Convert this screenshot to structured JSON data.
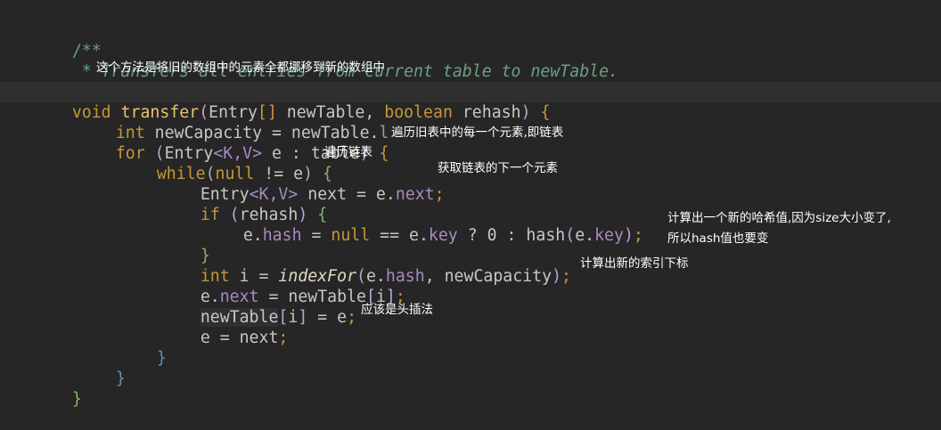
{
  "code": {
    "l1": "/**",
    "l2": " * Transfers all entries from current table to newTable.",
    "l3a": " */",
    "l4": {
      "kw": "void",
      "fn": "transfer",
      "p1": "(",
      "t1": "Entry",
      "b1": "[]",
      "v1": " newTable, ",
      "kw2": "boolean",
      "v2": " rehash",
      "p2": ")",
      "b2": " {"
    },
    "l5": {
      "kw": "int",
      "v": " newCapacity = newTable.",
      "f": "length",
      "s": ";"
    },
    "l6": {
      "kw": "for",
      "p1": " (",
      "t": "Entry",
      "g": "<K,V>",
      "v": " e : table",
      "p2": ")",
      "b": " {"
    },
    "l7": {
      "kw": "while",
      "p1": "(",
      "kw2": "null",
      "v": " != e",
      "p2": ")",
      "b": " {"
    },
    "l8": {
      "t": "Entry",
      "g": "<K,V>",
      "v": " next = e.",
      "f": "next",
      "s": ";"
    },
    "l9": {
      "kw": "if",
      "p1": " (",
      "v": "rehash",
      "p2": ")",
      "b": " {"
    },
    "l10": {
      "v1": "e.",
      "f1": "hash",
      "v2": " = ",
      "kw": "null",
      "v3": " == e.",
      "f2": "key",
      "v4": " ? ",
      "n": "0",
      "v5": " : hash",
      "p1": "(",
      "v6": "e.",
      "f3": "key",
      "p2": ")",
      "s": ";"
    },
    "l11": "}",
    "l12": {
      "kw": "int",
      "v1": " i = ",
      "it": "indexFor",
      "p1": "(",
      "v2": "e.",
      "f": "hash",
      "v3": ", newCapacity",
      "p2": ")",
      "s": ";"
    },
    "l13": {
      "v1": "e.",
      "f": "next",
      "v2": " = newTable",
      "b": "[",
      "v3": "i",
      "b2": "]",
      "s": ";"
    },
    "l14": {
      "v1": "newTable",
      "b": "[",
      "v2": "i",
      "b2": "]",
      "v3": " = e",
      "s": ";"
    },
    "l15": {
      "v": "e = next",
      "s": ";"
    },
    "l16": "}",
    "l17": "}",
    "l18": "}"
  },
  "annotations": {
    "a1": "这个方法是将旧的数组中的元素全都挪移到新的数组中",
    "a2": "遍历旧表中的每一个元素,即链表",
    "a3": "遍历链表",
    "a4": "获取链表的下一个元素",
    "a5_1": "计算出一个新的哈希值,因为size大小变了,",
    "a5_2": "所以hash值也要变",
    "a6": "计算出新的索引下标",
    "a7": "应该是头插法"
  },
  "colors": {
    "background": "#262626",
    "comment": "#6e9f84",
    "keyword": "#c6973a",
    "function": "#e9c46a",
    "field": "#a78bc0",
    "brace": "#5b8fc9",
    "annotation_text": "#ffffff"
  }
}
